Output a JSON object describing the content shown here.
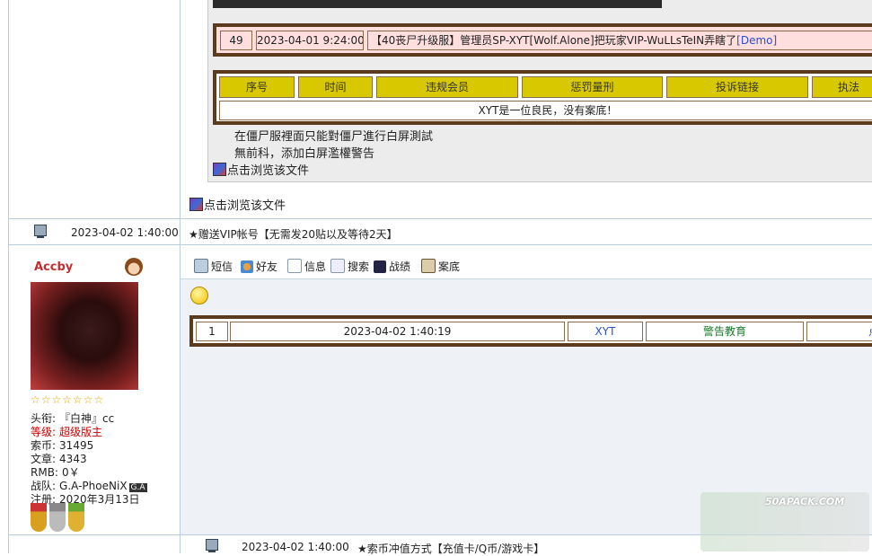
{
  "quote": {
    "log_row": {
      "num": "49",
      "time": "2023-04-01 9:24:00",
      "text": "【40丧尸升级服】管理员SP-XYT[Wolf.Alone]把玩家VIP-WuLLsTeIN弄瞎了",
      "link": "[Demo]"
    },
    "table_headers": [
      "序号",
      "时间",
      "违规会员",
      "惩罚量刑",
      "投诉链接",
      "执法"
    ],
    "table_message": "XYT是一位良民，没有案底！",
    "lines": [
      "在僵尸服裡面只能對僵尸進行白屏測試",
      "無前科，添加白屏濫權警告"
    ],
    "file_link": "点击浏览该文件"
  },
  "post1": {
    "file_link": "点击浏览该文件",
    "time": "2023-04-02 1:40:00",
    "title": "★赠送VIP帐号【无需发20贴以及等待2天】"
  },
  "user": {
    "name": "Accby",
    "stars": "☆☆☆☆☆☆☆",
    "title_label": "头衔:",
    "title_value": "『白神』cc",
    "level_label": "等级:",
    "level_value": "超级版主",
    "coins_label": "索币:",
    "coins_value": "31495",
    "posts_label": "文章:",
    "posts_value": "4343",
    "rmb_label": "RMB:",
    "rmb_value": "0￥",
    "team_label": "战队:",
    "team_value": "G.A-PhoeNiX",
    "team_badge": "G.A",
    "reg_label": "注册:",
    "reg_value": "2020年3月13日"
  },
  "toolbar": {
    "sms": "短信",
    "friend": "好友",
    "info": "信息",
    "search": "搜索",
    "record": "战绩",
    "case": "案底"
  },
  "record_row": {
    "num": "1",
    "time": "2023-04-02 1:40:19",
    "member": "XYT",
    "penalty": "警告教育",
    "link": "点"
  },
  "post2": {
    "time": "2023-04-02 1:40:00",
    "title": "★索币冲值方式【充值卡/Q币/游戏卡】"
  },
  "watermark": {
    "text": "50APACK.COM"
  },
  "colors": {
    "border_brown": "#5c3a1e",
    "header_yellow": "#d8c800",
    "pink_row": "#ffdede",
    "link_blue": "#2a4fd0",
    "level_red": "#d00000",
    "name_red": "#c03030"
  }
}
